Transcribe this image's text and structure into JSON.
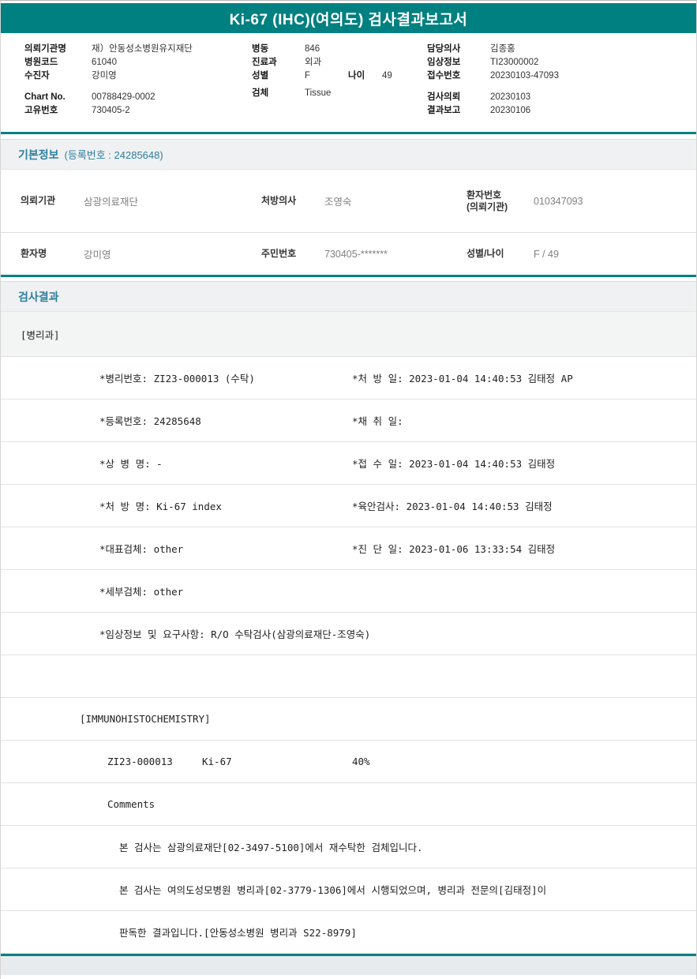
{
  "colors": {
    "accent": "#008080",
    "section_title": "#2e7f9e"
  },
  "title": "Ki-67 (IHC)(여의도) 검사결과보고서",
  "patient_header": {
    "left": [
      {
        "label": "의뢰기관명",
        "value": "재）안동성소병원유지재단"
      },
      {
        "label": "병원코드",
        "value": "61040"
      },
      {
        "label": "수진자",
        "value": "강미영"
      },
      {
        "label": "Chart No.",
        "value": "00788429-0002"
      },
      {
        "label": "고유번호",
        "value": "730405-2"
      }
    ],
    "middle": [
      {
        "label": "병동",
        "value": "846"
      },
      {
        "label": "진료과",
        "value": "외과"
      },
      {
        "label": "성별",
        "value": "F"
      },
      {
        "label": "검체",
        "value": "Tissue"
      }
    ],
    "age": {
      "label": "나이",
      "value": "49"
    },
    "right": [
      {
        "label": "담당의사",
        "value": "김종홍"
      },
      {
        "label": "임상정보",
        "value": "TI23000002"
      },
      {
        "label": "접수번호",
        "value": "20230103-47093"
      },
      {
        "label": "검사의뢰",
        "value": "20230103"
      },
      {
        "label": "결과보고",
        "value": "20230106"
      }
    ]
  },
  "basic_info": {
    "title": "기본정보",
    "subtitle": "(등록번호 : 24285648)",
    "row1": [
      {
        "label": "의뢰기관",
        "value": "삼광의료재단"
      },
      {
        "label": "처방의사",
        "value": "조영숙"
      },
      {
        "label": "환자번호\n(의뢰기관)",
        "value": "010347093"
      }
    ],
    "row2": [
      {
        "label": "환자명",
        "value": "강미영"
      },
      {
        "label": "주민번호",
        "value": "730405-*******"
      },
      {
        "label": "성별/나이",
        "value": "F / 49"
      }
    ]
  },
  "results": {
    "title": "검사결과",
    "department": "[병리과]",
    "rows": [
      {
        "left": "*병리번호: ZI23-000013 (수탁)",
        "right": "*처 방 일: 2023-01-04 14:40:53 김태정 AP"
      },
      {
        "left": "*등록번호: 24285648",
        "right": "*채 취 일:"
      },
      {
        "left": "*상 병 명: -",
        "right": "*접 수 일: 2023-01-04 14:40:53  김태정"
      },
      {
        "left": "*처 방 명: Ki-67 index",
        "right": "*육안검사: 2023-01-04 14:40:53  김태정"
      },
      {
        "left": "*대표검체: other",
        "right": "*진 단 일: 2023-01-06 13:33:54  김태정"
      },
      {
        "left": "*세부검체: other",
        "right": ""
      },
      {
        "left": "*임상정보 및 요구사항: R/O 수탁검사(삼광의료재단-조영숙)",
        "right": ""
      }
    ],
    "ihc_header": "[IMMUNOHISTOCHEMISTRY]",
    "ihc_result": {
      "code": "ZI23-000013",
      "test": "Ki-67",
      "value": "40%"
    },
    "comments_label": "Comments",
    "comments": [
      "본 검사는 삼광의료재단[02-3497-5100]에서 재수탁한 검체입니다.",
      "본 검사는 여의도성모병원 병리과[02-3779-1306]에서 시행되었으며, 병리과 전문의[김태정]이",
      "판독한 결과입니다.[안동성소병원 병리과 S22-8979]"
    ]
  }
}
